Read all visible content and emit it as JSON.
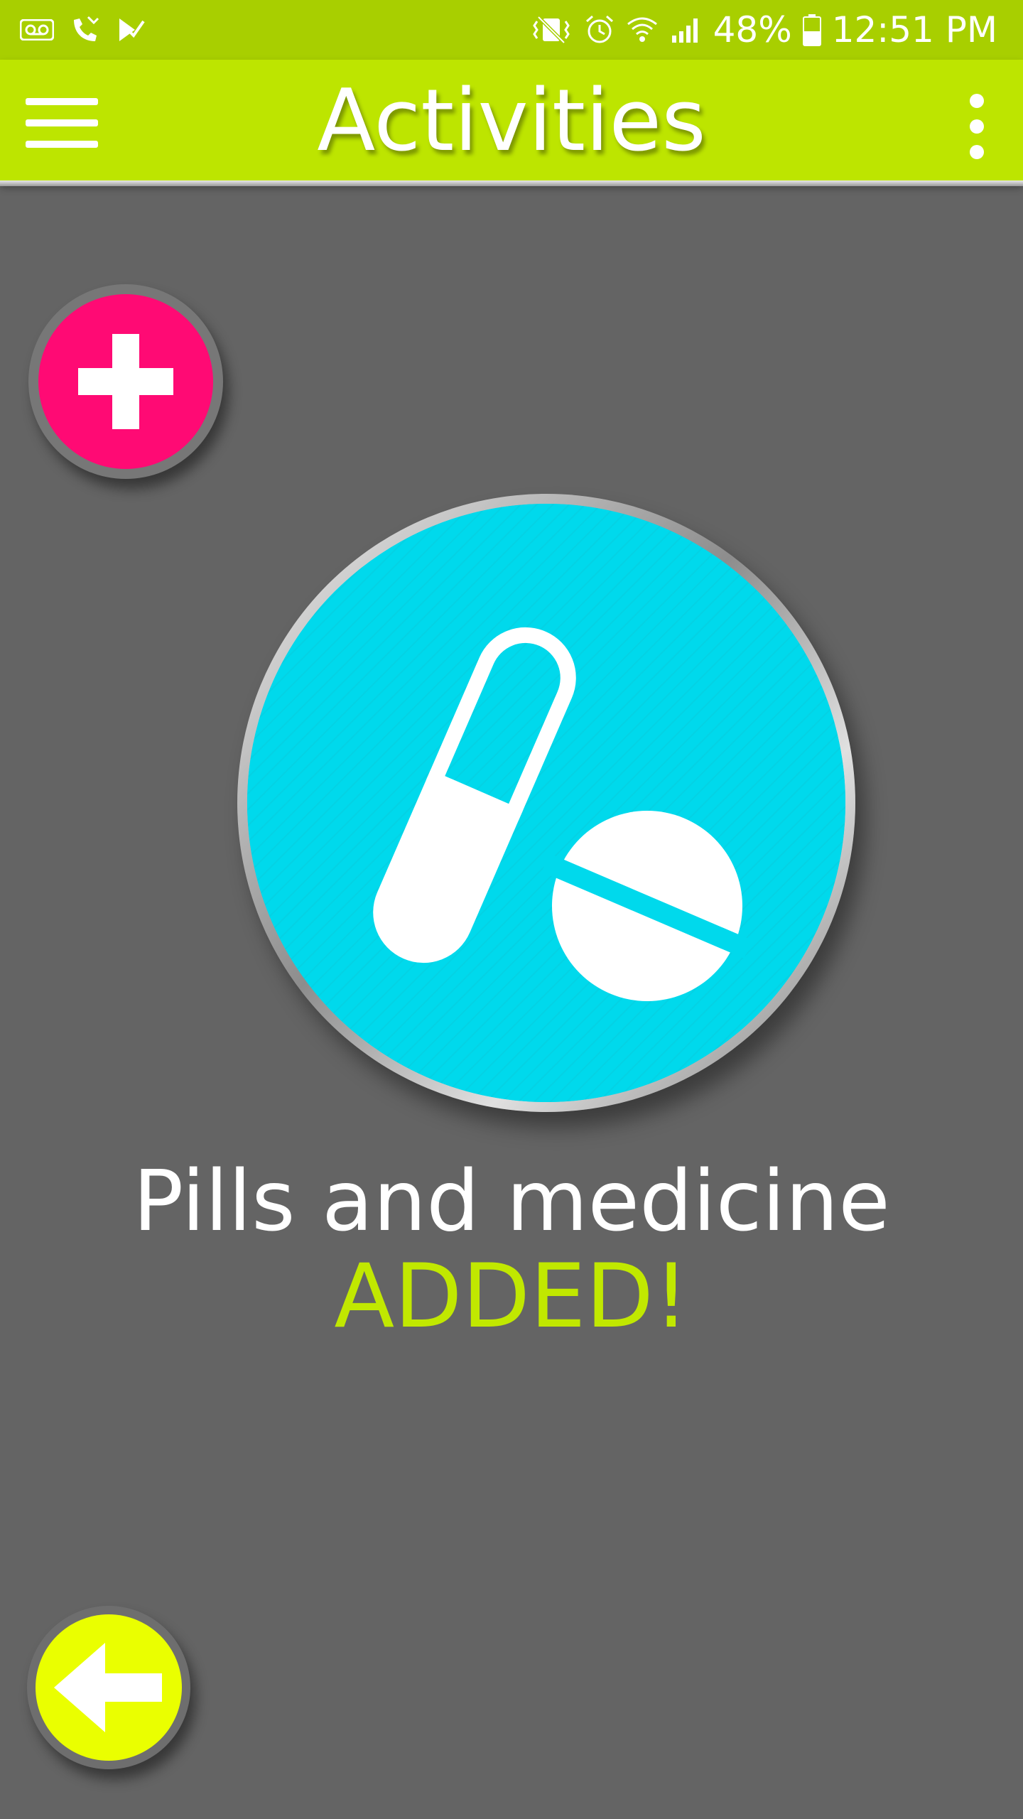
{
  "status_bar": {
    "battery": "48%",
    "time": "12:51 PM"
  },
  "app_bar": {
    "title": "Activities"
  },
  "main": {
    "item_name": "Pills and medicine",
    "status_text": "ADDED!"
  },
  "icons": {
    "menu": "menu-icon",
    "more": "more-vertical-icon",
    "add": "plus-icon",
    "medicine": "pills-icon",
    "back": "arrow-left-icon"
  },
  "colors": {
    "app_bar": "#bde500",
    "status_bar": "#a8cf00",
    "background": "#646464",
    "add_button": "#ff0a74",
    "medicine_circle": "#00d9ec",
    "status_text": "#c1e800",
    "back_button": "#eaff00"
  }
}
